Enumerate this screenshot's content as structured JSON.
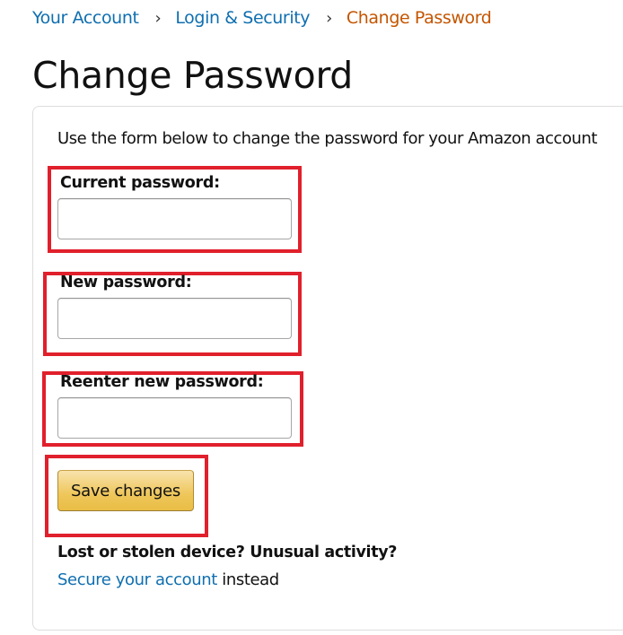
{
  "breadcrumb": {
    "items": [
      {
        "label": "Your Account",
        "link": true
      },
      {
        "label": "Login & Security",
        "link": true
      },
      {
        "label": "Change Password",
        "link": false
      }
    ],
    "separator": "›"
  },
  "page": {
    "title": "Change Password"
  },
  "form": {
    "intro": "Use the form below to change the password for your Amazon account",
    "fields": [
      {
        "label": "Current password:",
        "value": "",
        "placeholder": ""
      },
      {
        "label": "New password:",
        "value": "",
        "placeholder": ""
      },
      {
        "label": "Reenter new password:",
        "value": "",
        "placeholder": ""
      }
    ],
    "save_label": "Save changes"
  },
  "security": {
    "heading": "Lost or stolen device? Unusual activity?",
    "link_label": "Secure your account",
    "suffix": " instead"
  },
  "colors": {
    "link": "#0f6fb0",
    "current_crumb": "#c45500",
    "highlight": "#e0202c",
    "button": "#eec65a"
  }
}
